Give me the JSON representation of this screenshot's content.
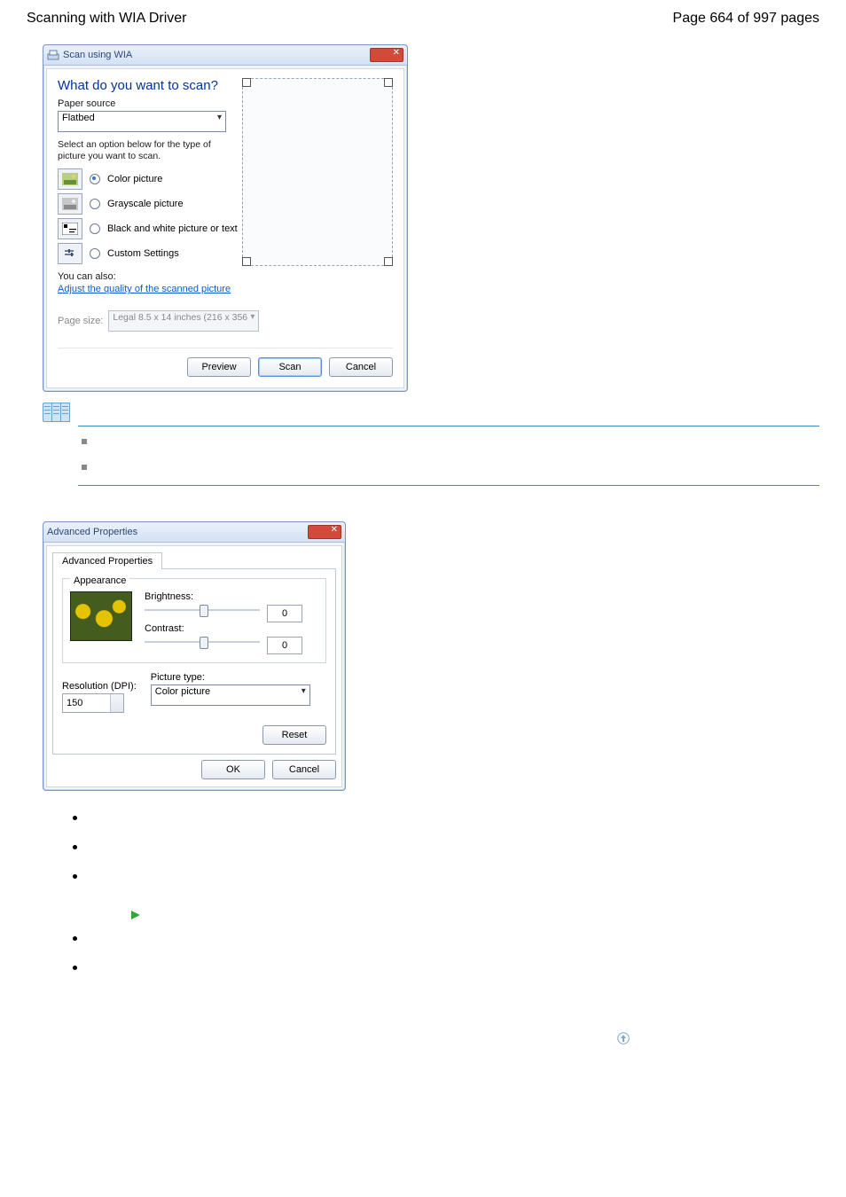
{
  "header": {
    "left": "Scanning with WIA Driver",
    "right": "Page 664 of 997 pages"
  },
  "scan": {
    "title": "Scan using WIA",
    "heading": "What do you want to scan?",
    "paper_source_label": "Paper source",
    "paper_source_value": "Flatbed",
    "instruction": "Select an option below for the type of picture you want to scan.",
    "options": [
      "Color picture",
      "Grayscale picture",
      "Black and white picture or text",
      "Custom Settings"
    ],
    "you_can_also": "You can also:",
    "adjust_link": "Adjust the quality of the scanned picture",
    "page_size_label": "Page size:",
    "page_size_value": "Legal 8.5 x 14 inches (216 x 356 ",
    "buttons": [
      "Preview",
      "Scan",
      "Cancel"
    ]
  },
  "adv": {
    "title": "Advanced Properties",
    "tab": "Advanced Properties",
    "appearance": "Appearance",
    "brightness": "Brightness:",
    "brightness_val": "0",
    "contrast": "Contrast:",
    "contrast_val": "0",
    "resolution": "Resolution (DPI):",
    "resolution_val": "150",
    "picture_type": "Picture type:",
    "picture_type_val": "Color picture",
    "reset": "Reset",
    "ok": "OK",
    "cancel": "Cancel"
  }
}
